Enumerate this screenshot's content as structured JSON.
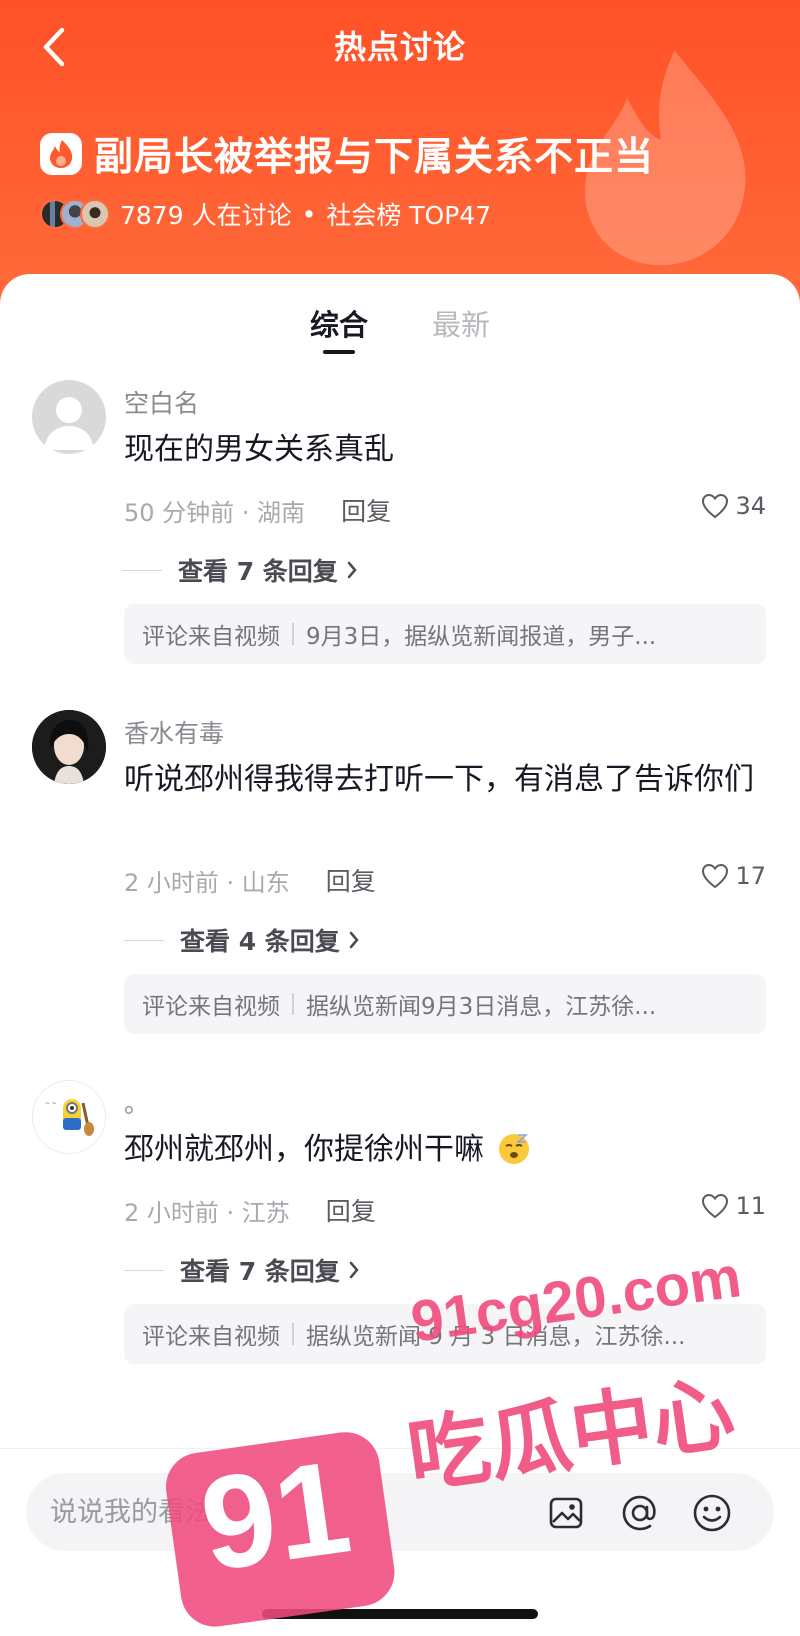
{
  "header": {
    "title": "热点讨论",
    "topic_title": "副局长被举报与下属关系不正当",
    "discussing": "7879 人在讨论",
    "separator": "•",
    "rank": "社会榜 TOP47"
  },
  "tabs": [
    {
      "label": "综合",
      "active": true
    },
    {
      "label": "最新",
      "active": false
    }
  ],
  "comments": [
    {
      "name": "空白名",
      "text": "现在的男女关系真乱",
      "time_location": "50 分钟前 · 湖南",
      "reply_label": "回复",
      "likes": "34",
      "view_replies": "查看 7 条回复",
      "source_label": "评论来自视频",
      "source_text": "9月3日，据纵览新闻报道，男子..."
    },
    {
      "name": "香水有毒",
      "text": "听说邳州得我得去打听一下，有消息了告诉你们",
      "time_location": "2 小时前 · 山东",
      "reply_label": "回复",
      "likes": "17",
      "view_replies": "查看 4 条回复",
      "source_label": "评论来自视频",
      "source_text": "据纵览新闻9月3日消息，江苏徐..."
    },
    {
      "name": "。",
      "text": "邳州就邳州，你提徐州干嘛",
      "time_location": "2 小时前 · 江苏",
      "reply_label": "回复",
      "likes": "11",
      "view_replies": "查看 7 条回复",
      "source_label": "评论来自视频",
      "source_text": "据纵览新闻 9 月 3 日消息，江苏徐..."
    }
  ],
  "input": {
    "placeholder": "说说我的看法"
  },
  "watermark": {
    "number": "91",
    "site": "91cg20.com",
    "label": "吃瓜中心"
  },
  "colors": {
    "header": "#ff5a2e",
    "watermark": "#f04b7d"
  },
  "icons": [
    "back-arrow-icon",
    "flame-icon",
    "heart-icon",
    "chevron-right-icon",
    "image-icon",
    "at-icon",
    "emoji-icon"
  ]
}
